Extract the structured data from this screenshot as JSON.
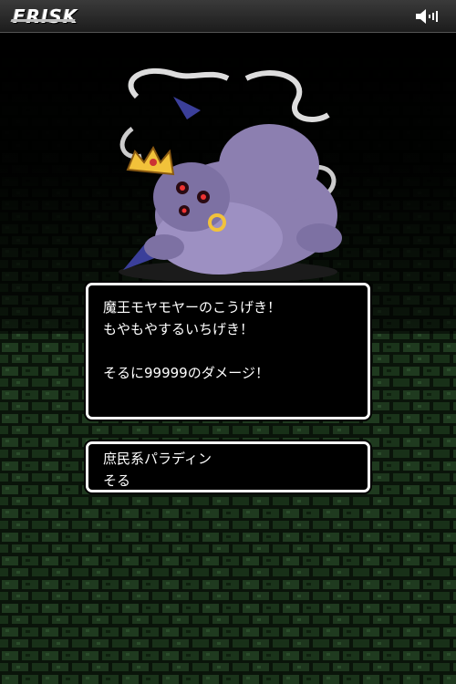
{
  "header": {
    "logo_text": "FRISK",
    "sound_icon": "speaker-volume-icon"
  },
  "battle": {
    "enemy_icon": "purple-demon-king-monster-icon",
    "message_lines": [
      "魔王モヤモヤーのこうげき！",
      "もやもやするいちげき！",
      "そるに99999のダメージ！"
    ]
  },
  "party": {
    "class_name": "庶民系パラディン",
    "hero_name": "そる"
  },
  "colors": {
    "background": "#000000",
    "brick_green": "#1f3a1f",
    "window_border": "#ffffff",
    "monster_purple": "#8c7fb0"
  }
}
